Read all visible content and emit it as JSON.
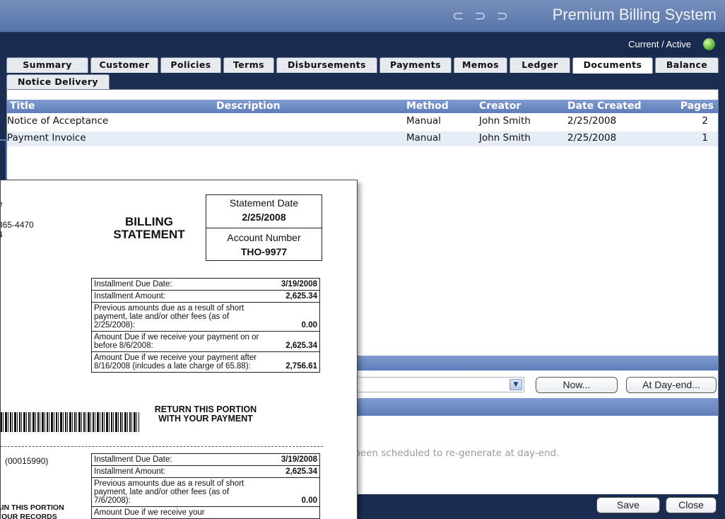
{
  "header": {
    "brand_mark": "⊂ ⊃ ⊃",
    "app_title": "Premium Billing System",
    "status": "Current / Active",
    "status_color": "#5fb83a"
  },
  "tabs_row1": [
    "Summary",
    "Customer",
    "Policies",
    "Terms",
    "Disbursements",
    "Payments",
    "Memos",
    "Ledger",
    "Documents",
    "Balance"
  ],
  "active_tab": "Documents",
  "tabs_row2": [
    "Notice Delivery"
  ],
  "documents_grid": {
    "columns": [
      "Title",
      "Description",
      "Method",
      "Creator",
      "Date Created",
      "Pages"
    ],
    "rows": [
      {
        "title": "Notice of Acceptance",
        "description": "",
        "method": "Manual",
        "creator": "John Smith",
        "date": "2/25/2008",
        "pages": "2"
      },
      {
        "title": "Payment Invoice",
        "description": "",
        "method": "Manual",
        "creator": "John Smith",
        "date": "2/25/2008",
        "pages": "1"
      }
    ]
  },
  "schedule": {
    "dropdown_value": "",
    "now_button": "Now...",
    "dayend_button": "At Day-end...",
    "message": "s been scheduled to re-generate at day-end."
  },
  "footer": {
    "save": "Save",
    "close": "Close"
  },
  "statement": {
    "cut_lines": [
      "e",
      "365-4470",
      "4"
    ],
    "title_line1": "BILLING",
    "title_line2": "STATEMENT",
    "statement_date_label": "Statement Date",
    "statement_date": "2/25/2008",
    "account_number_label": "Account Number",
    "account_number": "THO-9977",
    "top_table": [
      {
        "text": "Installment Due Date:",
        "amount": "3/19/2008"
      },
      {
        "text": "Installment Amount:",
        "amount": "2,625.34"
      },
      {
        "text": "Previous amounts due as a result of short payment, late and/or other fees (as of 2/25/2008):",
        "amount": "0.00"
      },
      {
        "text": "Amount Due if we receive your payment on or before 8/6/2008:",
        "amount": "2,625.34"
      },
      {
        "text": "Amount Due if we receive your payment after 8/16/2008 (inlcudes a late charge of 65.88):",
        "amount": "2,756.61"
      }
    ],
    "return_line1": "RETURN THIS PORTION",
    "return_line2": "WITH YOUR PAYMENT",
    "ref_code": "(00015990)",
    "bottom_table": [
      {
        "text": "Installment Due Date:",
        "amount": "3/19/2008"
      },
      {
        "text": "Installment Amount:",
        "amount": "2,625.34"
      },
      {
        "text": "Previous amounts due as a result of short payment, late and/or other fees (as of 7/6/2008):",
        "amount": "0.00"
      },
      {
        "text": "Amount Due if we receive your",
        "amount": ""
      }
    ],
    "retain_line1": "AIN THIS PORTION",
    "retain_line2": "YOUR RECORDS"
  }
}
